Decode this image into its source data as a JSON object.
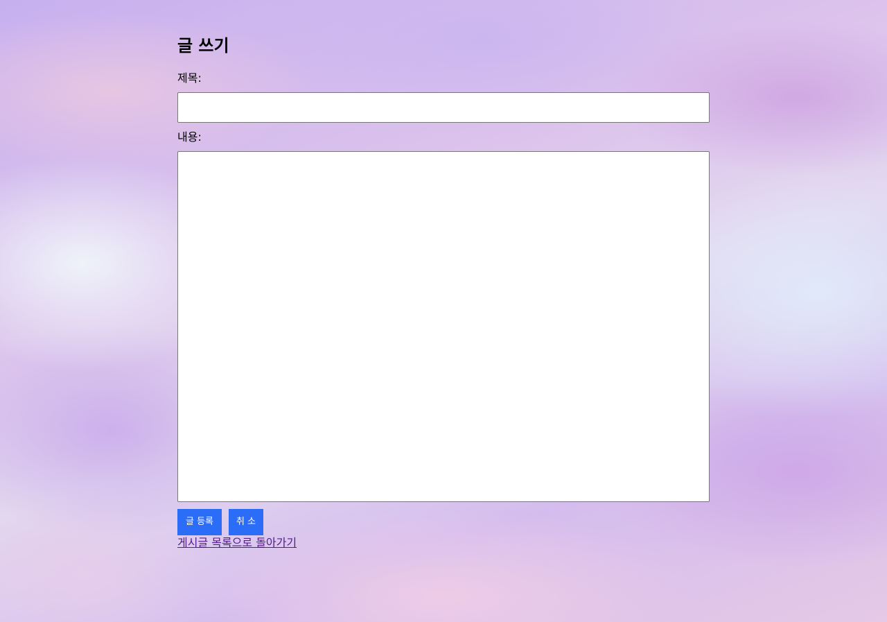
{
  "page": {
    "heading": "글 쓰기"
  },
  "form": {
    "title_label": "제목:",
    "title_value": "",
    "content_label": "내용:",
    "content_value": "",
    "submit_label": "글 등록",
    "cancel_label": "취 소"
  },
  "nav": {
    "back_link": "게시글 목록으로 돌아가기"
  },
  "colors": {
    "button": "#2c6df8",
    "visited_link": "#551a8b"
  }
}
